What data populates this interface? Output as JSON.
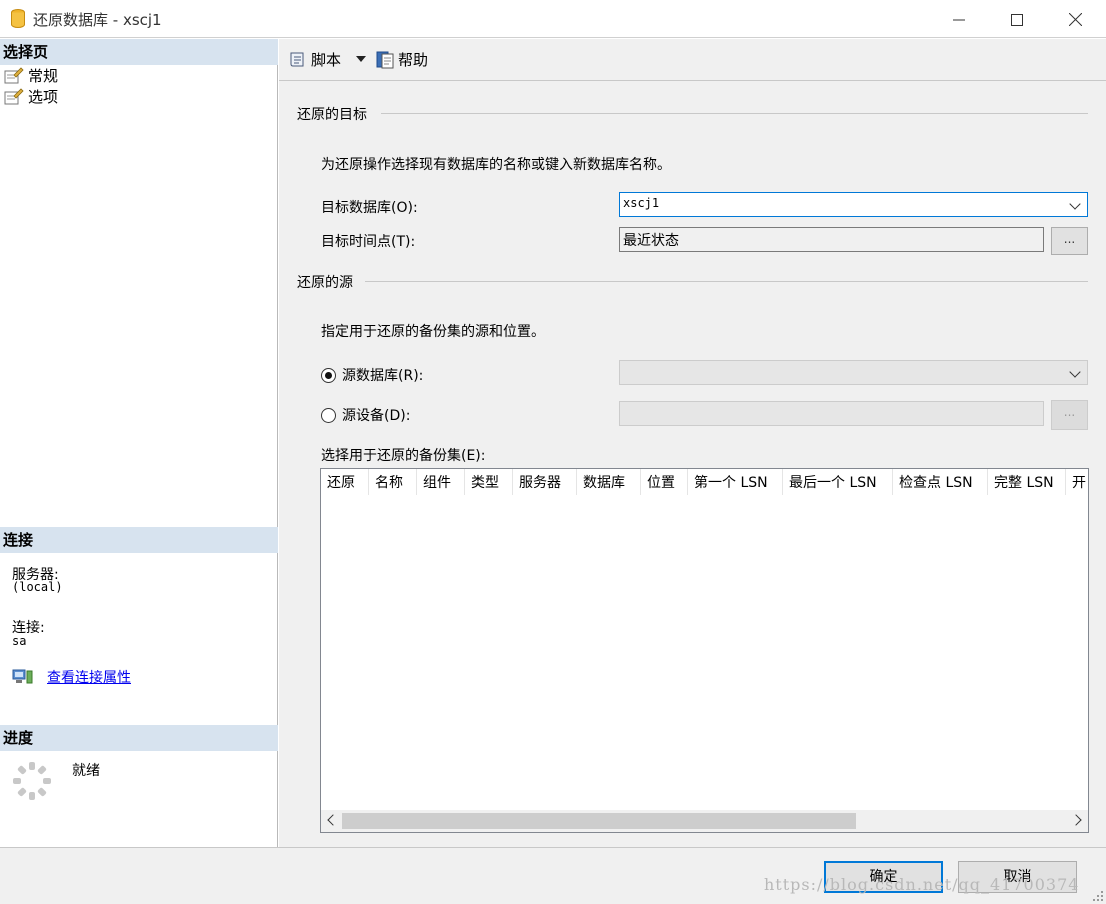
{
  "window": {
    "title": "还原数据库 - xscj1",
    "controls": [
      "minimize",
      "maximize",
      "close"
    ]
  },
  "sidebar": {
    "select_page_header": "选择页",
    "pages": [
      {
        "label": "常规",
        "icon": "page-settings-icon"
      },
      {
        "label": "选项",
        "icon": "page-settings-icon"
      }
    ],
    "connection_header": "连接",
    "server_label": "服务器:",
    "server_value": "(local)",
    "connection_label": "连接:",
    "connection_value": "sa",
    "view_props_link": "查看连接属性",
    "progress_header": "进度",
    "progress_status": "就绪"
  },
  "toolbar": {
    "script_label": "脚本",
    "help_label": "帮助"
  },
  "destination": {
    "group_label": "还原的目标",
    "description": "为还原操作选择现有数据库的名称或键入新数据库名称。",
    "target_db_label": "目标数据库(O):",
    "target_db_value": "xscj1",
    "target_time_label": "目标时间点(T):",
    "target_time_value": "最近状态",
    "ellipsis": "..."
  },
  "source": {
    "group_label": "还原的源",
    "description": "指定用于还原的备份集的源和位置。",
    "from_database_label": "源数据库(R):",
    "from_device_label": "源设备(D):",
    "selected_option": "from_database",
    "ellipsis": "...",
    "backup_sets_label": "选择用于还原的备份集(E):",
    "columns": [
      "还原",
      "名称",
      "组件",
      "类型",
      "服务器",
      "数据库",
      "位置",
      "第一个 LSN",
      "最后一个 LSN",
      "检查点 LSN",
      "完整 LSN",
      "开"
    ]
  },
  "buttons": {
    "ok": "确定",
    "cancel": "取消"
  },
  "watermark": "https://blog.csdn.net/qq_41700374",
  "colors": {
    "section_header_bg": "#d7e3ef",
    "link": "#0000ee",
    "focus_border": "#0078d7",
    "pane_bg": "#f0f0f0"
  }
}
